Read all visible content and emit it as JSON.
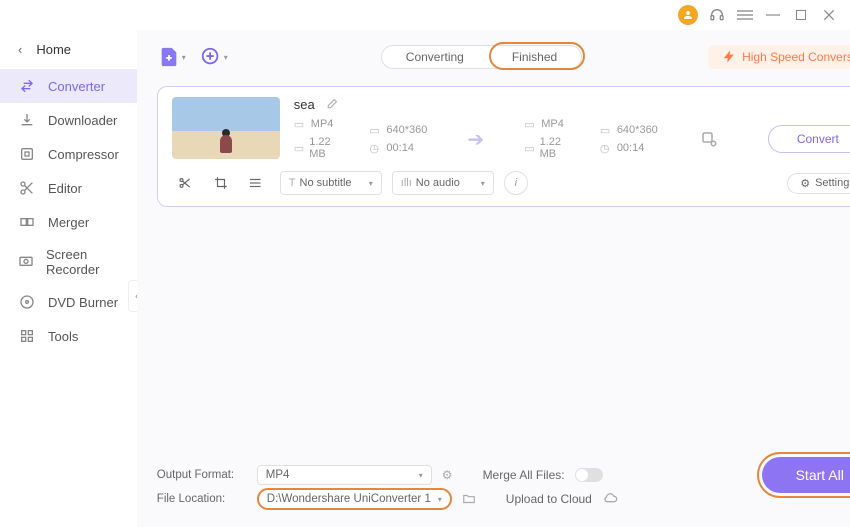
{
  "titlebar": {
    "icons": [
      "avatar",
      "headset",
      "menu",
      "minimize",
      "maximize",
      "close"
    ]
  },
  "sidebar": {
    "home": "Home",
    "items": [
      {
        "icon": "converter",
        "label": "Converter",
        "active": true
      },
      {
        "icon": "downloader",
        "label": "Downloader"
      },
      {
        "icon": "compressor",
        "label": "Compressor"
      },
      {
        "icon": "editor",
        "label": "Editor"
      },
      {
        "icon": "merger",
        "label": "Merger"
      },
      {
        "icon": "recorder",
        "label": "Screen Recorder"
      },
      {
        "icon": "dvd",
        "label": "DVD Burner"
      },
      {
        "icon": "tools",
        "label": "Tools"
      }
    ]
  },
  "toolbar": {
    "tabs": {
      "converting": "Converting",
      "finished": "Finished",
      "active": "finished"
    },
    "highspeed": "High Speed Conversion"
  },
  "item": {
    "title": "sea",
    "source": {
      "format": "MP4",
      "resolution": "640*360",
      "size": "1.22 MB",
      "duration": "00:14"
    },
    "target": {
      "format": "MP4",
      "resolution": "640*360",
      "size": "1.22 MB",
      "duration": "00:14"
    },
    "convert_btn": "Convert",
    "subtitle_select": "No subtitle",
    "audio_select": "No audio",
    "settings_btn": "Settings"
  },
  "footer": {
    "output_format_label": "Output Format:",
    "output_format_value": "MP4",
    "file_location_label": "File Location:",
    "file_location_value": "D:\\Wondershare UniConverter 1",
    "merge_label": "Merge All Files:",
    "upload_label": "Upload to Cloud",
    "start_all": "Start All"
  }
}
